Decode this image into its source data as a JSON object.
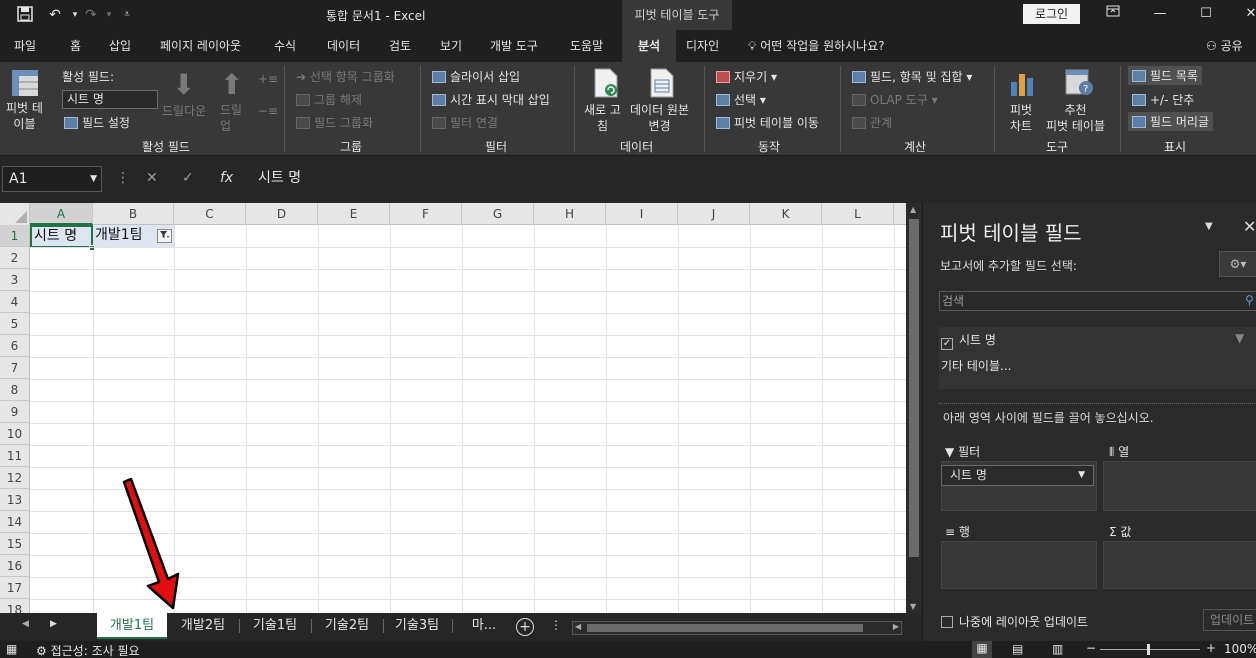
{
  "titlebar": {
    "doc_title": "통합 문서1  -  Excel",
    "context_tab": "피벗 테이블 도구",
    "login": "로그인"
  },
  "tabs": [
    "파일",
    "홈",
    "삽입",
    "페이지 레이아웃",
    "수식",
    "데이터",
    "검토",
    "보기",
    "개발 도구",
    "도움말",
    "분석",
    "디자인"
  ],
  "active_tab": "분석",
  "tellme": "어떤 작업을 원하시나요?",
  "share": "공유",
  "ribbon": {
    "pivot_table": "피벗 테\n이블",
    "active_field_label": "활성 필드:",
    "active_field_value": "시트 명",
    "field_settings": "필드 설정",
    "drilldown": "드릴다운",
    "drillup": "드릴\n업",
    "group_active_field": "활성 필드",
    "group_selection": "선택 항목 그룹화",
    "ungroup": "그룹 해제",
    "group_field": "필드 그룹화",
    "group_group": "그룹",
    "insert_slicer": "슬라이서 삽입",
    "insert_timeline": "시간 표시 막대 삽입",
    "filter_connections": "필터 연결",
    "group_filter": "필터",
    "refresh": "새로 고\n침",
    "change_source": "데이터 원본\n변경",
    "group_data": "데이터",
    "clear": "지우기",
    "select": "선택",
    "move_pivot": "피벗 테이블 이동",
    "group_actions": "동작",
    "fields_items_sets": "필드, 항목 및 집합",
    "olap_tools": "OLAP 도구",
    "relationships": "관계",
    "group_calc": "계산",
    "pivot_chart": "피벗\n차트",
    "recommended": "추천\n피벗 테이블",
    "group_tools": "도구",
    "field_list": "필드 목록",
    "buttons": "+/- 단추",
    "field_headers": "필드 머리글",
    "group_show": "표시"
  },
  "formula": {
    "namebox": "A1",
    "value": "시트 명"
  },
  "columns": [
    "A",
    "B",
    "C",
    "D",
    "E",
    "F",
    "G",
    "H",
    "I",
    "J",
    "K",
    "L"
  ],
  "rows": [
    "1",
    "2",
    "3",
    "4",
    "5",
    "6",
    "7",
    "8",
    "9",
    "10",
    "11",
    "12",
    "13",
    "14",
    "15",
    "16",
    "17",
    "18"
  ],
  "cells": {
    "a1": "시트 명",
    "b1": "개발1팀"
  },
  "sheets": [
    "개발1팀",
    "개발2팀",
    "기술1팀",
    "기술2팀",
    "기술3팀",
    "마..."
  ],
  "active_sheet": "개발1팀",
  "status": {
    "accessibility": "접근성: 조사 필요",
    "zoom": "100%"
  },
  "pivot_pane": {
    "title": "피벗 테이블 필드",
    "subtitle": "보고서에 추가할 필드 선택:",
    "search_placeholder": "검색",
    "field": "시트 명",
    "more_tables": "기타 테이블...",
    "hint": "아래 영역 사이에 필드를 끌어 놓으십시오.",
    "area_filter": "필터",
    "area_columns": "열",
    "area_rows": "행",
    "area_values": "값",
    "filter_chip": "시트 명",
    "defer": "나중에 레이아웃 업데이트",
    "update": "업데이트"
  }
}
